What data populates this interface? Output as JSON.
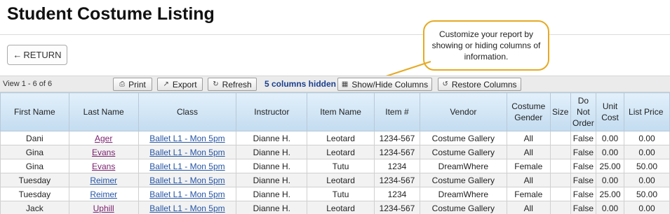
{
  "page": {
    "title": "Student Costume Listing"
  },
  "nav": {
    "return_label": "RETURN"
  },
  "toolbar": {
    "view_count": "View 1 - 6 of 6",
    "print_label": "Print",
    "export_label": "Export",
    "refresh_label": "Refresh",
    "hidden_columns": "5 columns hidden",
    "show_hide_label": "Show/Hide Columns",
    "restore_label": "Restore Columns"
  },
  "callout": {
    "text": "Customize your report by showing or hiding columns of information."
  },
  "table": {
    "columns": [
      "First Name",
      "Last Name",
      "Class",
      "Instructor",
      "Item Name",
      "Item #",
      "Vendor",
      "Costume Gender",
      "Size",
      "Do Not Order",
      "Unit Cost",
      "List Price"
    ],
    "rows": [
      {
        "first_name": "Dani",
        "last_name": "Ager",
        "class": "Ballet L1 - Mon 5pm",
        "instructor": "Dianne H.",
        "item_name": "Leotard",
        "item_no": "1234-567",
        "vendor": "Costume Gallery",
        "gender": "All",
        "size": "",
        "do_not_order": "False",
        "unit_cost": "0.00",
        "list_price": "0.00"
      },
      {
        "first_name": "Gina",
        "last_name": "Evans",
        "class": "Ballet L1 - Mon 5pm",
        "instructor": "Dianne H.",
        "item_name": "Leotard",
        "item_no": "1234-567",
        "vendor": "Costume Gallery",
        "gender": "All",
        "size": "",
        "do_not_order": "False",
        "unit_cost": "0.00",
        "list_price": "0.00"
      },
      {
        "first_name": "Gina",
        "last_name": "Evans",
        "class": "Ballet L1 - Mon 5pm",
        "instructor": "Dianne H.",
        "item_name": "Tutu",
        "item_no": "1234",
        "vendor": "DreamWhere",
        "gender": "Female",
        "size": "",
        "do_not_order": "False",
        "unit_cost": "25.00",
        "list_price": "50.00"
      },
      {
        "first_name": "Tuesday",
        "last_name": "Reimer",
        "class": "Ballet L1 - Mon 5pm",
        "instructor": "Dianne H.",
        "item_name": "Leotard",
        "item_no": "1234-567",
        "vendor": "Costume Gallery",
        "gender": "All",
        "size": "",
        "do_not_order": "False",
        "unit_cost": "0.00",
        "list_price": "0.00"
      },
      {
        "first_name": "Tuesday",
        "last_name": "Reimer",
        "class": "Ballet L1 - Mon 5pm",
        "instructor": "Dianne H.",
        "item_name": "Tutu",
        "item_no": "1234",
        "vendor": "DreamWhere",
        "gender": "Female",
        "size": "",
        "do_not_order": "False",
        "unit_cost": "25.00",
        "list_price": "50.00"
      },
      {
        "first_name": "Jack",
        "last_name": "Uphill",
        "class": "Ballet L1 - Mon 5pm",
        "instructor": "Dianne H.",
        "item_name": "Leotard",
        "item_no": "1234-567",
        "vendor": "Costume Gallery",
        "gender": "All",
        "size": "",
        "do_not_order": "False",
        "unit_cost": "0.00",
        "list_price": "0.00"
      }
    ]
  }
}
